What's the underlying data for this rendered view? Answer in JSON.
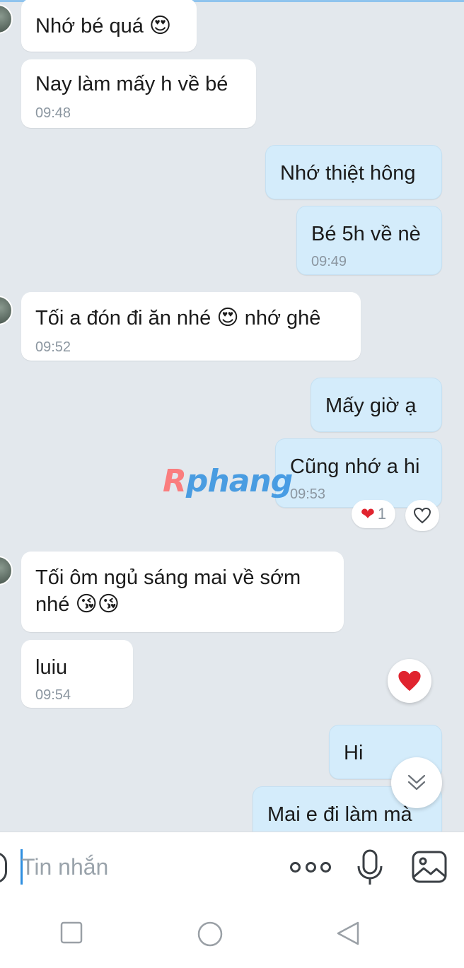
{
  "messages": [
    {
      "text": "Nhớ bé quá",
      "emoji": "😍",
      "time": ""
    },
    {
      "text": "Nay làm mấy h về bé",
      "time": "09:48"
    },
    {
      "text": "Nhớ thiệt hông",
      "time": ""
    },
    {
      "text": "Bé 5h về nè",
      "time": "09:49"
    },
    {
      "text": "Tối a đón đi ăn nhé",
      "emoji": "😍",
      "text2": "nhớ ghê",
      "time": "09:52"
    },
    {
      "text": "Mấy giờ ạ",
      "time": ""
    },
    {
      "text": "Cũng nhớ a hi",
      "time": "09:53"
    },
    {
      "text": "Tối ôm ngủ sáng mai về sớm nhé",
      "emoji": "😘😘",
      "time": ""
    },
    {
      "text": "luiu",
      "time": "09:54"
    },
    {
      "text": "Hi",
      "time": ""
    },
    {
      "text": "Mai e đi làm mà",
      "time": ""
    }
  ],
  "reaction": {
    "emoji": "❤",
    "count": "1"
  },
  "watermark": {
    "first": "R",
    "rest": "phang"
  },
  "composer": {
    "placeholder": "Tin nhắn",
    "value": ""
  },
  "colors": {
    "incoming": "#ffffff",
    "outgoing": "#d4ecfb",
    "background": "#e3e8ed",
    "accent": "#2f8fe0",
    "heart": "#e0242f"
  },
  "icons": [
    "emoji-icon",
    "more-icon",
    "microphone-icon",
    "image-icon",
    "heart-icon",
    "chevron-double-down-icon",
    "square-icon",
    "circle-icon",
    "back-triangle-icon"
  ]
}
